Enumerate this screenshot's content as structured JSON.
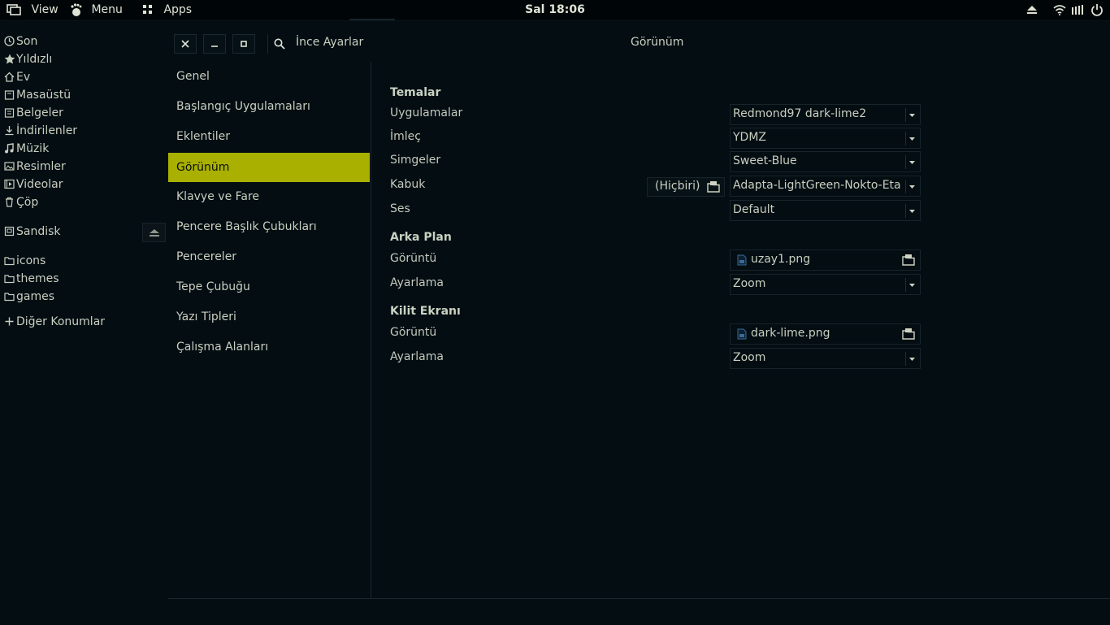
{
  "topbar": {
    "view_label": "View",
    "menu_label": "Menu",
    "apps_label": "Apps",
    "clock": "Sal 18:06",
    "tray_icons": [
      "eject-icon",
      "wifi-icon",
      "volume-icon",
      "power-icon"
    ]
  },
  "places": {
    "items": [
      {
        "label": "Son",
        "icon": "clock-icon"
      },
      {
        "label": "Yıldızlı",
        "icon": "star-icon"
      },
      {
        "label": "Ev",
        "icon": "home-icon"
      },
      {
        "label": "Masaüstü",
        "icon": "folder-icon"
      },
      {
        "label": "Belgeler",
        "icon": "folder-icon"
      },
      {
        "label": "İndirilenler",
        "icon": "download-icon"
      },
      {
        "label": "Müzik",
        "icon": "music-icon"
      },
      {
        "label": "Resimler",
        "icon": "image-icon"
      },
      {
        "label": "Videolar",
        "icon": "video-icon"
      },
      {
        "label": "Çöp",
        "icon": "trash-icon"
      }
    ],
    "device": {
      "label": "Sandisk",
      "icon": "drive-icon"
    },
    "bookmarks": [
      {
        "label": "icons",
        "icon": "folder-icon"
      },
      {
        "label": "themes",
        "icon": "folder-icon"
      },
      {
        "label": "games",
        "icon": "folder-icon"
      }
    ],
    "other_locations": "Diğer Konumlar"
  },
  "window": {
    "app_title": "İnce Ayarlar",
    "panel_title": "Görünüm"
  },
  "sidebar": {
    "items": [
      {
        "label": "Genel"
      },
      {
        "label": "Başlangıç Uygulamaları"
      },
      {
        "label": "Eklentiler"
      },
      {
        "label": "Görünüm",
        "active": true
      },
      {
        "label": "Klavye ve Fare"
      },
      {
        "label": "Pencere Başlık Çubukları"
      },
      {
        "label": "Pencereler"
      },
      {
        "label": "Tepe Çubuğu"
      },
      {
        "label": "Yazı Tipleri"
      },
      {
        "label": "Çalışma Alanları"
      }
    ]
  },
  "content": {
    "themes": {
      "title": "Temalar",
      "applications": {
        "label": "Uygulamalar",
        "value": "Redmond97 dark-lime2"
      },
      "cursor": {
        "label": "İmleç",
        "value": "YDMZ"
      },
      "icons": {
        "label": "Simgeler",
        "value": "Sweet-Blue"
      },
      "shell": {
        "label": "Kabuk",
        "value": "Adapta-LightGreen-Nokto-Eta",
        "none_button": "(Hiçbiri)"
      },
      "sound": {
        "label": "Ses",
        "value": "Default"
      }
    },
    "background": {
      "title": "Arka Plan",
      "image": {
        "label": "Görüntü",
        "value": "uzay1.png"
      },
      "adjust": {
        "label": "Ayarlama",
        "value": "Zoom"
      }
    },
    "lockscreen": {
      "title": "Kilit Ekranı",
      "image": {
        "label": "Görüntü",
        "value": "dark-lime.png"
      },
      "adjust": {
        "label": "Ayarlama",
        "value": "Zoom"
      }
    }
  },
  "colors": {
    "background": "#030d12",
    "accent": "#a9b000",
    "text": "#c9cfc0"
  }
}
